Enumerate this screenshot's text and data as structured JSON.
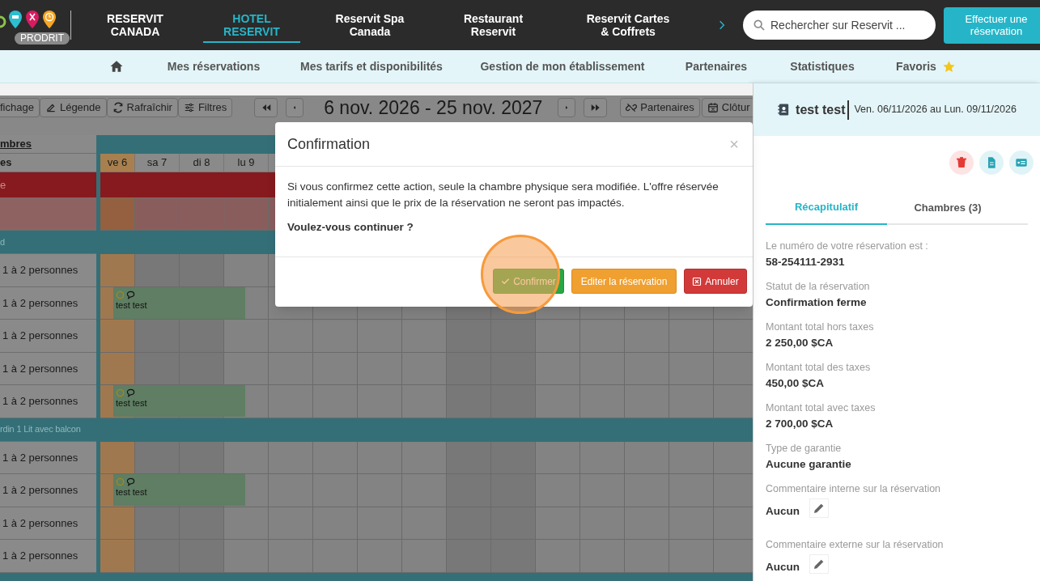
{
  "top_nav": {
    "badge": "PRODRIT",
    "items": [
      {
        "label": "RESERVIT CANADA",
        "selected": false
      },
      {
        "label": "HOTEL RESERVIT",
        "selected": true
      },
      {
        "label": "Reservit Spa Canada",
        "selected": false
      },
      {
        "label": "Restaurant Reservit",
        "selected": false
      },
      {
        "label": "Reservit Cartes & Coffrets",
        "selected": false
      }
    ],
    "search": {
      "placeholder": "Rechercher sur Reservit ..."
    },
    "cta": "Effectuer une réservation"
  },
  "sub_nav": {
    "items": [
      {
        "label": "Mes réservations",
        "starred": false
      },
      {
        "label": "Mes tarifs et disponibilités",
        "starred": false
      },
      {
        "label": "Gestion de mon établissement",
        "starred": false
      },
      {
        "label": "Partenaires",
        "starred": false
      },
      {
        "label": "Statistiques",
        "starred": false
      },
      {
        "label": "Favoris",
        "starred": true
      }
    ]
  },
  "planning": {
    "toolbar_left": [
      "fichage",
      "Légende",
      "Rafraîchir",
      "Filtres"
    ],
    "period": "6 nov. 2026 - 25 nov. 2027",
    "toolbar_right": [
      "Partenaires",
      "Clôtur"
    ],
    "days": [
      {
        "label": "ve 6",
        "kind": "today"
      },
      {
        "label": "sa 7",
        "kind": "weekend"
      },
      {
        "label": "di 8",
        "kind": "weekend"
      },
      {
        "label": "lu 9",
        "kind": "weekday"
      },
      {
        "kind": "weekday"
      },
      {
        "kind": "weekday"
      },
      {
        "kind": "weekday"
      },
      {
        "kind": "weekday"
      },
      {
        "kind": "weekend"
      },
      {
        "kind": "weekend"
      },
      {
        "kind": "weekday"
      },
      {
        "kind": "weekday"
      },
      {
        "kind": "weekday"
      },
      {
        "kind": "weekday"
      },
      {
        "kind": "weekday"
      }
    ],
    "rows": [
      {
        "kind": "header",
        "label": "mbres"
      },
      {
        "kind": "days",
        "label": "es"
      },
      {
        "kind": "closed",
        "label": "e"
      },
      {
        "kind": "blocked"
      },
      {
        "kind": "category",
        "label": "d"
      },
      {
        "kind": "room",
        "label": "1 à 2 personnes"
      },
      {
        "kind": "room",
        "label": "1 à 2 personnes",
        "booking": "test test"
      },
      {
        "kind": "room",
        "label": "1 à 2 personnes"
      },
      {
        "kind": "room",
        "label": "1 à 2 personnes"
      },
      {
        "kind": "room",
        "label": "1 à 2 personnes",
        "booking": "test test"
      },
      {
        "kind": "category",
        "label": "rdin 1 Lit avec balcon"
      },
      {
        "kind": "room",
        "label": "1 à 2 personnes"
      },
      {
        "kind": "room",
        "label": "1 à 2 personnes",
        "booking": "test test"
      },
      {
        "kind": "room",
        "label": "1 à 2 personnes"
      },
      {
        "kind": "room",
        "label": "1 à 2 personnes"
      },
      {
        "kind": "category"
      }
    ]
  },
  "modal": {
    "title": "Confirmation",
    "close": "×",
    "message": "Si vous confirmez cette action, seule la chambre physique sera modifiée. L'offre réservée initialement ainsi que le prix de la réservation ne seront pas impactés.",
    "question": "Voulez-vous continuer ?",
    "buttons": [
      {
        "label": "Confirmer",
        "kind": "confirm"
      },
      {
        "label": "Editer la réservation",
        "kind": "edit"
      },
      {
        "label": "Annuler",
        "kind": "cancel"
      }
    ]
  },
  "panel": {
    "guest": "test test",
    "dates": "Ven. 06/11/2026 au Lun. 09/11/2026",
    "tabs": [
      {
        "label": "Récapitulatif",
        "selected": true
      },
      {
        "label": "Chambres (3)",
        "selected": false
      }
    ],
    "fields": [
      {
        "label": "Le numéro de votre réservation est :",
        "value": "58-254111-2931",
        "editable": false
      },
      {
        "label": "Statut de la réservation",
        "value": "Confirmation ferme",
        "editable": false
      },
      {
        "label": "Montant total hors taxes",
        "value": "2 250,00 $CA",
        "editable": false
      },
      {
        "label": "Montant total des taxes",
        "value": "450,00 $CA",
        "editable": false
      },
      {
        "label": "Montant total avec taxes",
        "value": "2 700,00 $CA",
        "editable": false
      },
      {
        "label": "Type de garantie",
        "value": "Aucune garantie",
        "editable": false
      },
      {
        "label": "Commentaire interne sur la réservation",
        "value": "Aucun",
        "editable": true
      },
      {
        "label": "Commentaire externe sur la réservation",
        "value": "Aucun",
        "editable": true
      }
    ]
  }
}
